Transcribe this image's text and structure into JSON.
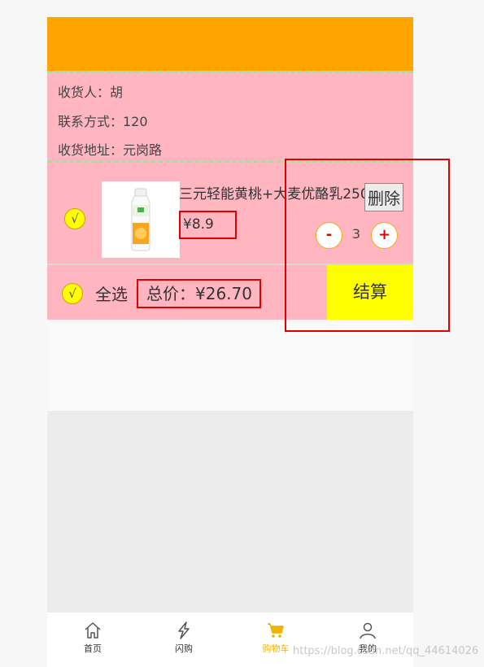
{
  "address": {
    "recipient": "收货人：胡",
    "contact": "联系方式：120",
    "location": "收货地址：元岗路"
  },
  "product": {
    "check_mark": "√",
    "name": "三元轻能黄桃+大麦优酪乳250",
    "price": "¥8.9",
    "delete_label": "删除",
    "minus_label": "-",
    "plus_label": "+",
    "quantity": "3"
  },
  "footer": {
    "check_mark": "√",
    "select_all": "全选",
    "total": "总价：¥26.70",
    "pay_label": "结算"
  },
  "tabbar": {
    "items": [
      {
        "label": "首页",
        "icon": "home-icon"
      },
      {
        "label": "闪购",
        "icon": "flash-icon"
      },
      {
        "label": "购物车",
        "icon": "cart-icon",
        "active": true
      },
      {
        "label": "我的",
        "icon": "user-icon"
      }
    ]
  },
  "watermark": "https://blog.csdn.net/qq_44614026",
  "colors": {
    "header": "#ffa500",
    "panel": "#ffb6c1",
    "accent_yellow": "#ffff00",
    "annotation_red": "#e00000",
    "active_tab": "#f0b400"
  }
}
